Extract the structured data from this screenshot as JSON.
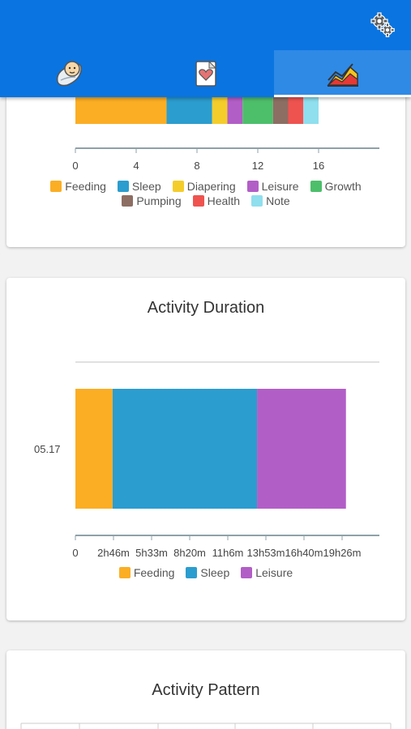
{
  "tabs": [
    {
      "name": "baby",
      "icon": "baby-icon",
      "active": false
    },
    {
      "name": "journal",
      "icon": "heart-note-icon",
      "active": false
    },
    {
      "name": "charts",
      "icon": "chart-icon",
      "active": true
    }
  ],
  "settings": {
    "icon": "gear-icon"
  },
  "colors": {
    "Feeding": "#fbae24",
    "Sleep": "#2b9dcf",
    "Diapering": "#f5cd2b",
    "Leisure": "#b25ec7",
    "Growth": "#4dbf6b",
    "Pumping": "#8d6e63",
    "Health": "#ef5350",
    "Note": "#8fdfee"
  },
  "chart_data": [
    {
      "type": "bar",
      "orientation": "horizontal",
      "stacked": true,
      "series": [
        {
          "name": "Feeding",
          "values": [
            6
          ]
        },
        {
          "name": "Sleep",
          "values": [
            3
          ]
        },
        {
          "name": "Diapering",
          "values": [
            1
          ]
        },
        {
          "name": "Leisure",
          "values": [
            1
          ]
        },
        {
          "name": "Growth",
          "values": [
            2
          ]
        },
        {
          "name": "Pumping",
          "values": [
            1
          ]
        },
        {
          "name": "Health",
          "values": [
            1
          ]
        },
        {
          "name": "Note",
          "values": [
            1
          ]
        }
      ],
      "xlim": [
        0,
        20
      ],
      "xticks": [
        "0",
        "4",
        "8",
        "12",
        "16"
      ],
      "legend": [
        "Feeding",
        "Sleep",
        "Diapering",
        "Leisure",
        "Growth",
        "Pumping",
        "Health",
        "Note"
      ],
      "legend_position": "bottom"
    },
    {
      "type": "bar",
      "orientation": "horizontal",
      "stacked": true,
      "title": "Activity Duration",
      "categories": [
        "05.17"
      ],
      "series": [
        {
          "name": "Feeding",
          "values": [
            2.45
          ]
        },
        {
          "name": "Sleep",
          "values": [
            9.5
          ]
        },
        {
          "name": "Leisure",
          "values": [
            5.85
          ]
        }
      ],
      "xlim": [
        0,
        20
      ],
      "xticks": [
        "0",
        "2h46m",
        "5h33m",
        "8h20m",
        "11h6m",
        "13h53m",
        "16h40m",
        "19h26m"
      ],
      "legend": [
        "Feeding",
        "Sleep",
        "Leisure"
      ],
      "legend_position": "bottom"
    }
  ],
  "pattern": {
    "title": "Activity Pattern"
  }
}
